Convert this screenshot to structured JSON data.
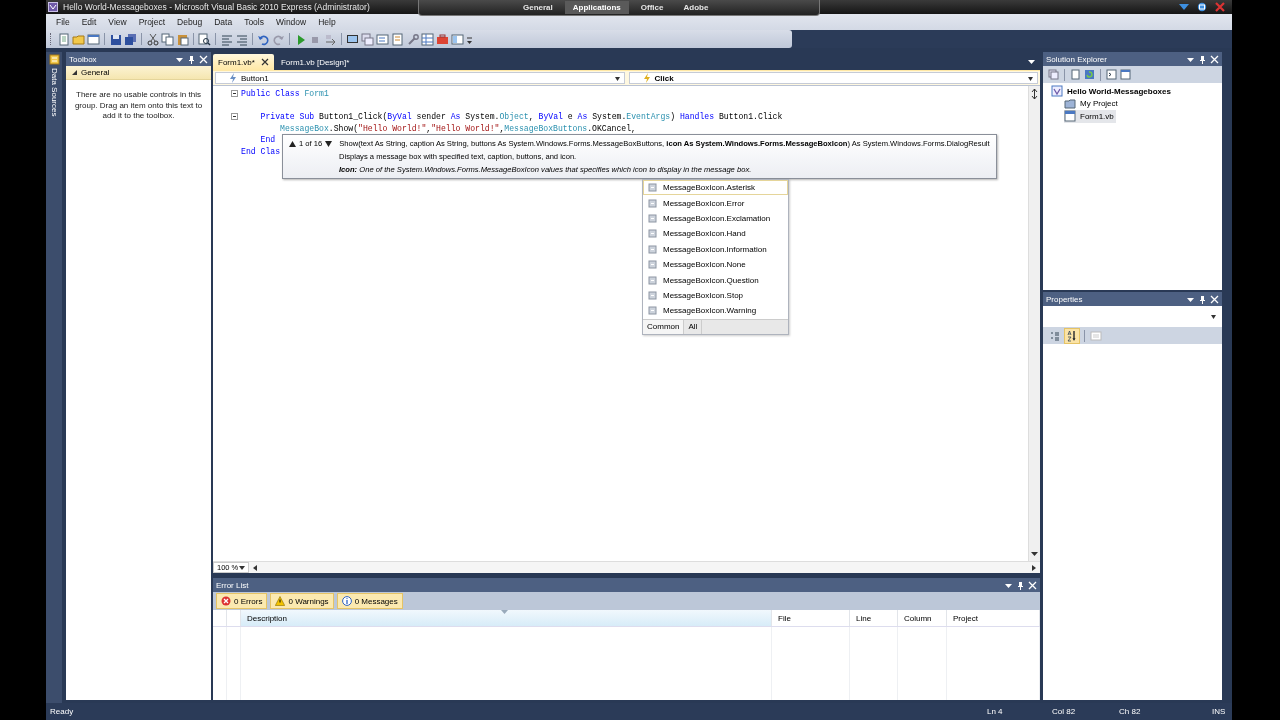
{
  "window": {
    "title": "Hello World-Messageboxes - Microsoft Visual Basic 2010 Express (Administrator)"
  },
  "launcher_tabs": [
    {
      "label": "General",
      "selected": false
    },
    {
      "label": "Applications",
      "selected": true
    },
    {
      "label": "Office",
      "selected": false
    },
    {
      "label": "Adobe",
      "selected": false
    }
  ],
  "menu": [
    "File",
    "Edit",
    "View",
    "Project",
    "Debug",
    "Data",
    "Tools",
    "Window",
    "Help"
  ],
  "side_tabs": [
    "Data Sources"
  ],
  "toolbox": {
    "title": "Toolbox",
    "groups": [
      {
        "label": "General",
        "expanded": true,
        "message": "There are no usable controls in this group. Drag an item onto this text to add it to the toolbox."
      }
    ]
  },
  "editor": {
    "tabs": [
      {
        "label": "Form1.vb*",
        "selected": true
      },
      {
        "label": "Form1.vb [Design]*",
        "selected": false
      }
    ],
    "object_dropdown": "Button1",
    "event_dropdown": "Click",
    "lines": [
      {
        "fold": true,
        "tokens": [
          {
            "kind": "kw",
            "text": "Public Class"
          },
          {
            "kind": "type",
            "text": " Form1"
          }
        ]
      },
      {
        "fold": false
      },
      {
        "fold": true,
        "tokens": [
          {
            "kind": "kw",
            "text": "    Private Sub"
          },
          {
            "kind": "text",
            "text": " Button1_Click("
          },
          {
            "kind": "kw",
            "text": "ByVal"
          },
          {
            "kind": "text",
            "text": " sender "
          },
          {
            "kind": "kw",
            "text": "As"
          },
          {
            "kind": "text",
            "text": " System."
          },
          {
            "kind": "type",
            "text": "Object"
          },
          {
            "kind": "text",
            "text": ", "
          },
          {
            "kind": "kw",
            "text": "ByVal"
          },
          {
            "kind": "text",
            "text": " e "
          },
          {
            "kind": "kw",
            "text": "As"
          },
          {
            "kind": "text",
            "text": " System."
          },
          {
            "kind": "type",
            "text": "EventArgs"
          },
          {
            "kind": "text",
            "text": ") "
          },
          {
            "kind": "kw",
            "text": "Handles"
          },
          {
            "kind": "text",
            "text": " Button1.Click"
          }
        ]
      },
      {
        "fold": false,
        "tokens": [
          {
            "kind": "type",
            "text": "        MessageBox"
          },
          {
            "kind": "text",
            "text": ".Show("
          },
          {
            "kind": "str",
            "text": "\"Hello World!\""
          },
          {
            "kind": "text",
            "text": ","
          },
          {
            "kind": "str",
            "text": "\"Hello World!\""
          },
          {
            "kind": "text",
            "text": ","
          },
          {
            "kind": "type",
            "text": "MessageBoxButtons"
          },
          {
            "kind": "text",
            "text": ".OKCancel,"
          }
        ]
      },
      {
        "fold": false,
        "tokens": [
          {
            "kind": "kw",
            "text": "    End"
          }
        ]
      },
      {
        "fold": false,
        "tokens": [
          {
            "kind": "kw",
            "text": "End Clas"
          }
        ]
      }
    ],
    "zoom": "100 %"
  },
  "parameter_info": {
    "counter": "1 of 16",
    "signature": "Show(text As String, caption As String, buttons As System.Windows.Forms.MessageBoxButtons, **icon As System.Windows.Forms.MessageBoxIcon**) As System.Windows.Forms.DialogResult",
    "description": "Displays a message box with specified text, caption, buttons, and icon.",
    "param": "**Icon:** One of the System.Windows.Forms.MessageBoxIcon values that specifies which icon to display in the message box."
  },
  "completion": {
    "items": [
      {
        "label": "MessageBoxIcon.Asterisk",
        "selected": true
      },
      {
        "label": "MessageBoxIcon.Error",
        "selected": false
      },
      {
        "label": "MessageBoxIcon.Exclamation",
        "selected": false
      },
      {
        "label": "MessageBoxIcon.Hand",
        "selected": false
      },
      {
        "label": "MessageBoxIcon.Information",
        "selected": false
      },
      {
        "label": "MessageBoxIcon.None",
        "selected": false
      },
      {
        "label": "MessageBoxIcon.Question",
        "selected": false
      },
      {
        "label": "MessageBoxIcon.Stop",
        "selected": false
      },
      {
        "label": "MessageBoxIcon.Warning",
        "selected": false
      }
    ],
    "tabs": [
      {
        "label": "Common",
        "selected": true
      },
      {
        "label": "All",
        "selected": false
      }
    ]
  },
  "solution_explorer": {
    "title": "Solution Explorer",
    "tree": [
      {
        "label": "Hello World-Messageboxes",
        "selected": false,
        "children": [
          {
            "label": "My Project",
            "selected": false
          },
          {
            "label": "Form1.vb",
            "selected": true
          }
        ]
      }
    ]
  },
  "properties": {
    "title": "Properties",
    "view_buttons": [
      {
        "kind": "categorized",
        "selected": false
      },
      {
        "kind": "alphabetical",
        "selected": true
      },
      {
        "kind": "pages",
        "selected": false
      }
    ]
  },
  "error_list": {
    "title": "Error List",
    "filters": [
      {
        "kind": "error",
        "label": "0 Errors",
        "on": true
      },
      {
        "kind": "warning",
        "label": "0 Warnings",
        "on": true
      },
      {
        "kind": "info",
        "label": "0 Messages",
        "on": true
      }
    ],
    "columns": [
      {
        "label": "Description",
        "sorted": true
      },
      {
        "label": "File",
        "sorted": false
      },
      {
        "label": "Line",
        "sorted": false
      },
      {
        "label": "Column",
        "sorted": false
      },
      {
        "label": "Project",
        "sorted": false
      }
    ]
  },
  "status_bar": [
    "Ready",
    "Ln 4",
    "Col 82",
    "Ch 82",
    "INS"
  ]
}
